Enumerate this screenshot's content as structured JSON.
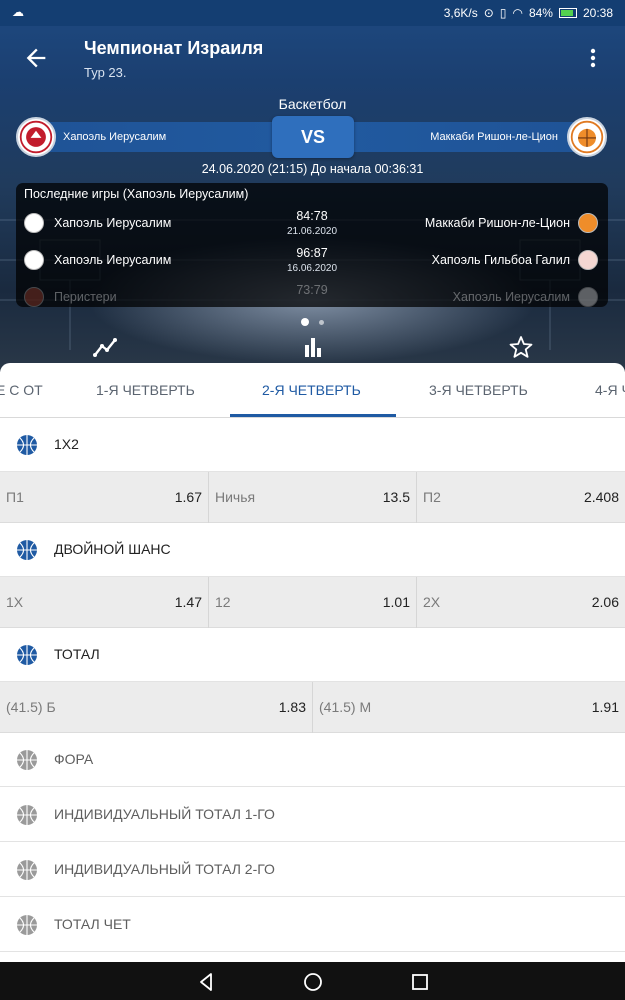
{
  "status_bar": {
    "speed": "3,6K/s",
    "battery": "84%",
    "time": "20:38"
  },
  "header": {
    "title": "Чемпионат Израиля",
    "subtitle": "Тур 23."
  },
  "match": {
    "sport": "Баскетбол",
    "vs": "VS",
    "home_team": "Хапоэль Иерусалим",
    "away_team": "Маккаби Ришон-ле-Цион",
    "datetime": "24.06.2020 (21:15)  До начала 00:36:31"
  },
  "last_games": {
    "heading": "Последние игры (Хапоэль Иерусалим)",
    "rows": [
      {
        "home": "Хапоэль Иерусалим",
        "score": "84:78",
        "date": "21.06.2020",
        "away": "Маккаби Ришон-ле-Цион"
      },
      {
        "home": "Хапоэль Иерусалим",
        "score": "96:87",
        "date": "16.06.2020",
        "away": "Хапоэль Гильбоа Галил"
      },
      {
        "home": "Перистери",
        "score": "73:79",
        "date": "",
        "away": "Хапоэль Иерусалим"
      }
    ]
  },
  "tabs": [
    {
      "label": "Е С ОТ"
    },
    {
      "label": "1-Я ЧЕТВЕРТЬ"
    },
    {
      "label": "2-Я ЧЕТВЕРТЬ"
    },
    {
      "label": "3-Я ЧЕТВЕРТЬ"
    },
    {
      "label": "4-Я Ч"
    }
  ],
  "markets": {
    "m1x2": {
      "title": "1X2",
      "odds": [
        {
          "label": "П1",
          "value": "1.67"
        },
        {
          "label": "Ничья",
          "value": "13.5"
        },
        {
          "label": "П2",
          "value": "2.408"
        }
      ]
    },
    "double_chance": {
      "title": "ДВОЙНОЙ ШАНС",
      "odds": [
        {
          "label": "1Х",
          "value": "1.47"
        },
        {
          "label": "12",
          "value": "1.01"
        },
        {
          "label": "2Х",
          "value": "2.06"
        }
      ]
    },
    "total": {
      "title": "ТОТАЛ",
      "odds": [
        {
          "label": "(41.5) Б",
          "value": "1.83"
        },
        {
          "label": "(41.5) М",
          "value": "1.91"
        }
      ]
    },
    "collapsed": [
      {
        "title": "ФОРА"
      },
      {
        "title": "ИНДИВИДУАЛЬНЫЙ ТОТАЛ 1-ГО"
      },
      {
        "title": "ИНДИВИДУАЛЬНЫЙ ТОТАЛ 2-ГО"
      },
      {
        "title": "ТОТАЛ ЧЕТ"
      }
    ]
  },
  "colors": {
    "accent": "#1f5aa3",
    "header_bg": "#1b3f70",
    "ball_active": "#1f5aa3",
    "ball_inactive": "#9a9a9a"
  },
  "icons": [
    "back-arrow-icon",
    "more-vert-icon",
    "line-chart-icon",
    "bar-chart-icon",
    "star-icon",
    "basketball-icon",
    "nav-back-icon",
    "nav-home-icon",
    "nav-recents-icon"
  ]
}
